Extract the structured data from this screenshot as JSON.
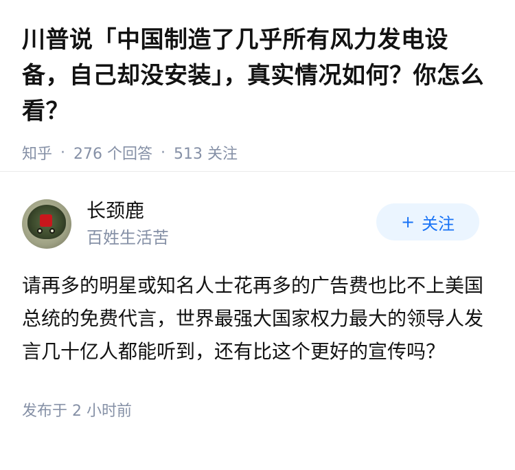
{
  "question": {
    "title": "川普说「中国制造了几乎所有风力发电设备，自己却没安装」，真实情况如何？你怎么看？",
    "source": "知乎",
    "answers_count": "276 个回答",
    "followers_count": "513 关注"
  },
  "answer": {
    "author_name": "长颈鹿",
    "author_bio": "百姓生活苦",
    "follow_label": "关注",
    "follow_icon": "plus-icon",
    "content": "请再多的明星或知名人士花再多的广告费也比不上美国总统的免费代言，世界最强大国家权力最大的领导人发言几十亿人都能听到，还有比这个更好的宣传吗？",
    "time": "发布于 2 小时前"
  },
  "colors": {
    "accent": "#1772f6",
    "meta_gray": "#8590a6",
    "follow_bg": "#ebf5ff"
  }
}
